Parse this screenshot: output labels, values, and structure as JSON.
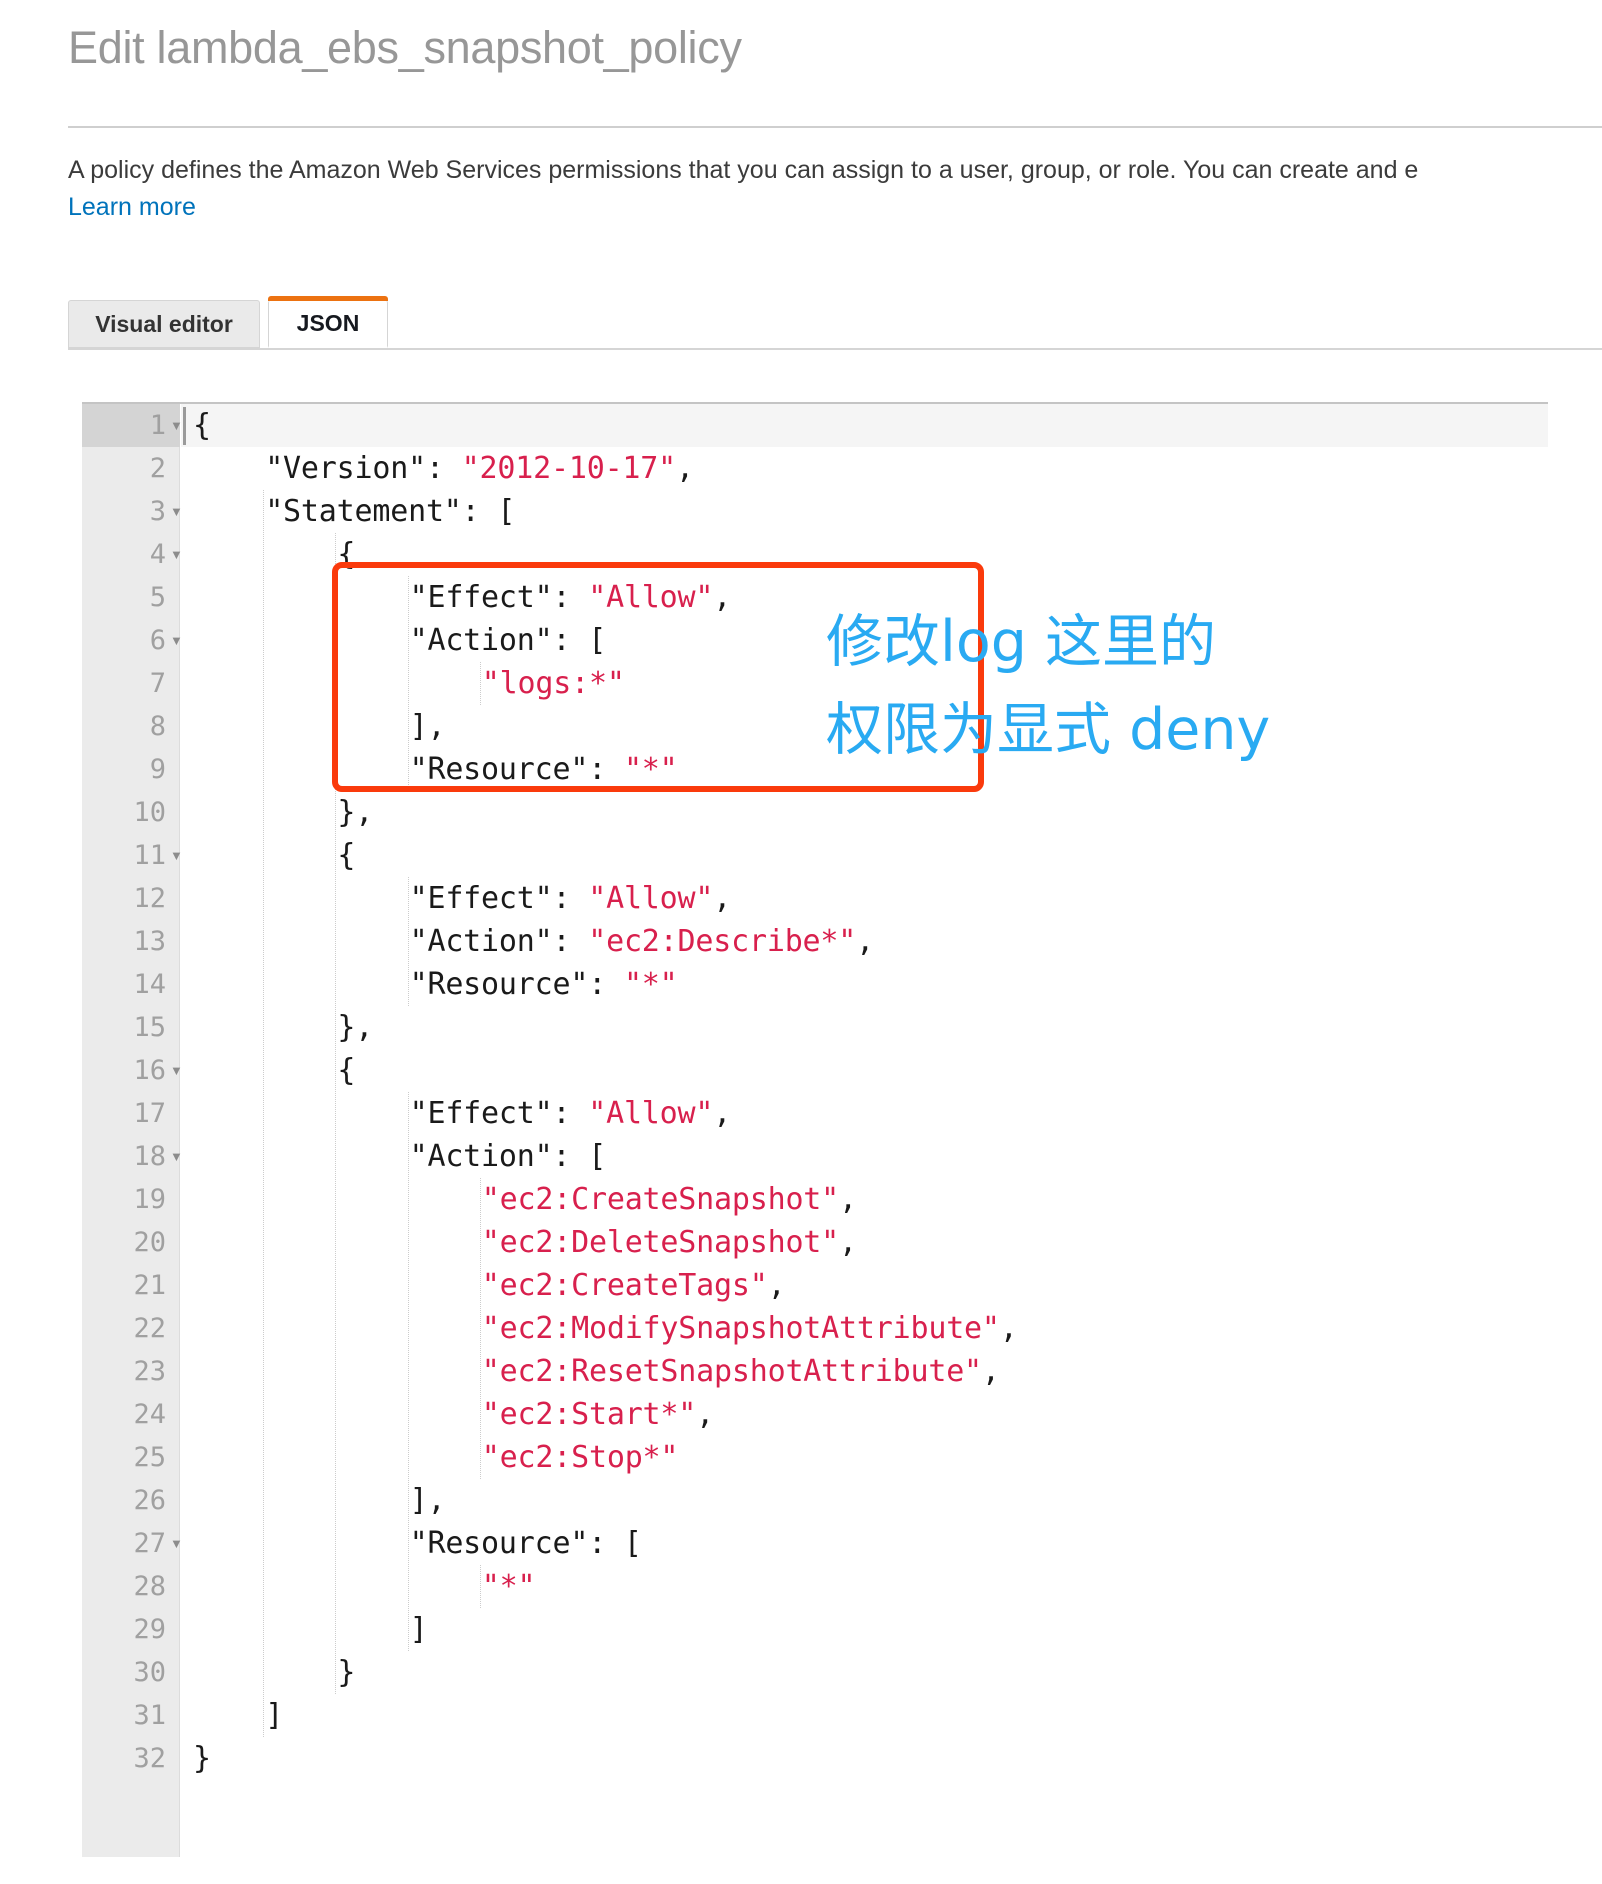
{
  "page": {
    "title": "Edit lambda_ebs_snapshot_policy",
    "description": "A policy defines the Amazon Web Services permissions that you can assign to a user, group, or role. You can create and e",
    "learn_more_label": "Learn more"
  },
  "tabs": [
    {
      "id": "visual-editor",
      "label": "Visual editor",
      "active": false
    },
    {
      "id": "json",
      "label": "JSON",
      "active": true
    }
  ],
  "colors": {
    "accent_orange": "#ec7211",
    "link_blue": "#0073bb",
    "string_red": "#d8204d",
    "annotation_cyan": "#29aaf2",
    "highlight_red": "#fa3a0c"
  },
  "editor": {
    "active_line": 1,
    "total_lines": 32,
    "fold_lines": [
      1,
      3,
      4,
      6,
      11,
      16,
      18,
      27
    ],
    "lines": [
      {
        "n": 1,
        "indent": 0,
        "text": "{"
      },
      {
        "n": 2,
        "indent": 1,
        "key": "\"Version\": ",
        "value": "\"2012-10-17\"",
        "tail": ","
      },
      {
        "n": 3,
        "indent": 1,
        "key": "\"Statement\": ["
      },
      {
        "n": 4,
        "indent": 2,
        "key": "{"
      },
      {
        "n": 5,
        "indent": 3,
        "key": "\"Effect\": ",
        "value": "\"Allow\"",
        "tail": ","
      },
      {
        "n": 6,
        "indent": 3,
        "key": "\"Action\": ["
      },
      {
        "n": 7,
        "indent": 4,
        "value": "\"logs:*\""
      },
      {
        "n": 8,
        "indent": 3,
        "key": "],"
      },
      {
        "n": 9,
        "indent": 3,
        "key": "\"Resource\": ",
        "value": "\"*\""
      },
      {
        "n": 10,
        "indent": 2,
        "key": "},"
      },
      {
        "n": 11,
        "indent": 2,
        "key": "{"
      },
      {
        "n": 12,
        "indent": 3,
        "key": "\"Effect\": ",
        "value": "\"Allow\"",
        "tail": ","
      },
      {
        "n": 13,
        "indent": 3,
        "key": "\"Action\": ",
        "value": "\"ec2:Describe*\"",
        "tail": ","
      },
      {
        "n": 14,
        "indent": 3,
        "key": "\"Resource\": ",
        "value": "\"*\""
      },
      {
        "n": 15,
        "indent": 2,
        "key": "},"
      },
      {
        "n": 16,
        "indent": 2,
        "key": "{"
      },
      {
        "n": 17,
        "indent": 3,
        "key": "\"Effect\": ",
        "value": "\"Allow\"",
        "tail": ","
      },
      {
        "n": 18,
        "indent": 3,
        "key": "\"Action\": ["
      },
      {
        "n": 19,
        "indent": 4,
        "value": "\"ec2:CreateSnapshot\"",
        "tail": ","
      },
      {
        "n": 20,
        "indent": 4,
        "value": "\"ec2:DeleteSnapshot\"",
        "tail": ","
      },
      {
        "n": 21,
        "indent": 4,
        "value": "\"ec2:CreateTags\"",
        "tail": ","
      },
      {
        "n": 22,
        "indent": 4,
        "value": "\"ec2:ModifySnapshotAttribute\"",
        "tail": ","
      },
      {
        "n": 23,
        "indent": 4,
        "value": "\"ec2:ResetSnapshotAttribute\"",
        "tail": ","
      },
      {
        "n": 24,
        "indent": 4,
        "value": "\"ec2:Start*\"",
        "tail": ","
      },
      {
        "n": 25,
        "indent": 4,
        "value": "\"ec2:Stop*\""
      },
      {
        "n": 26,
        "indent": 3,
        "key": "],"
      },
      {
        "n": 27,
        "indent": 3,
        "key": "\"Resource\": ["
      },
      {
        "n": 28,
        "indent": 4,
        "value": "\"*\""
      },
      {
        "n": 29,
        "indent": 3,
        "key": "]"
      },
      {
        "n": 30,
        "indent": 2,
        "key": "}"
      },
      {
        "n": 31,
        "indent": 1,
        "key": "]"
      },
      {
        "n": 32,
        "indent": 0,
        "key": "}"
      }
    ]
  },
  "annotation": {
    "line1": "修改log 这里的",
    "line2": "权限为显式 deny"
  }
}
